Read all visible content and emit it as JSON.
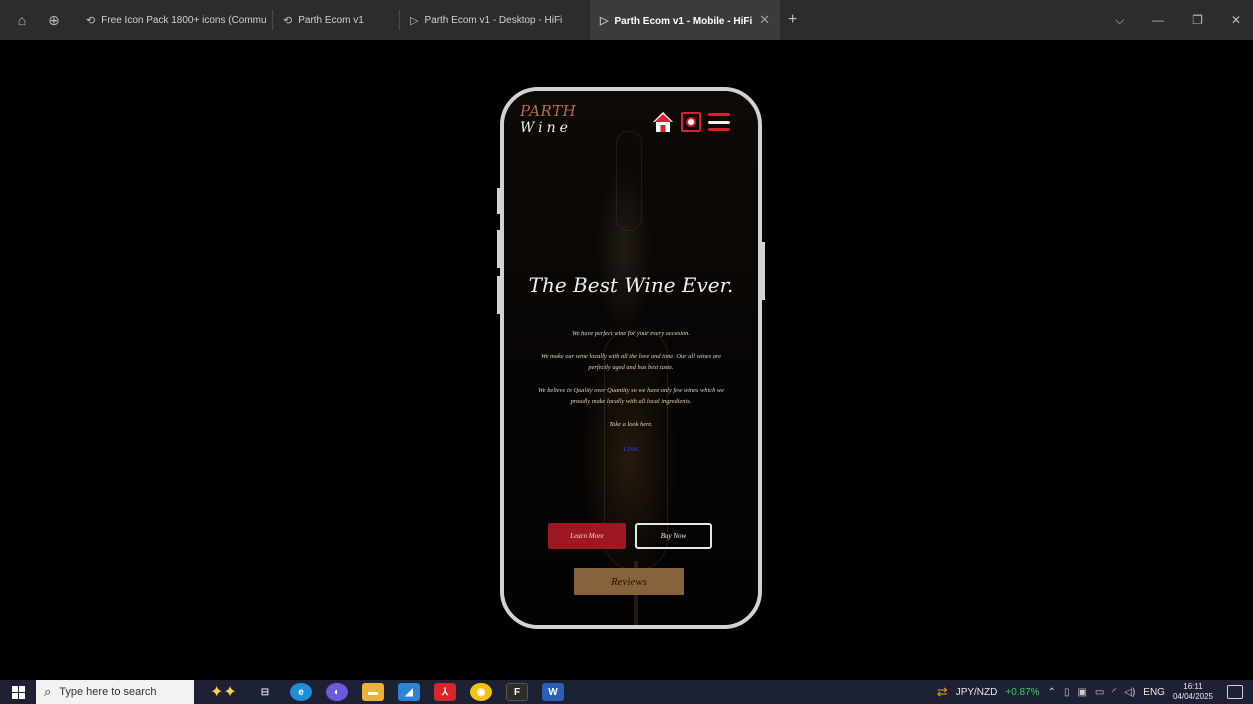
{
  "browser": {
    "tabs": [
      {
        "label": "Free Icon Pack 1800+ icons (Commu"
      },
      {
        "label": "Parth Ecom v1"
      },
      {
        "label": "Parth Ecom v1 - Desktop - HiFi"
      },
      {
        "label": "Parth Ecom v1 - Mobile - HiFi"
      }
    ],
    "new_tab": "+",
    "close_tab": "✕"
  },
  "site": {
    "logo_top": "PARTH",
    "logo_bottom": "Wine",
    "hero_title": "The Best Wine Ever.",
    "paragraphs": [
      "We have perfect wine for your every occasion.",
      "We make our wine locally with all the love and time. Our all wines are perfectly aged and has best taste.",
      "We believe in Quality over Quantity so we have only few wines which we proudly make locally with all local ingredients."
    ],
    "look_text": "Take a look here.",
    "link_text": "LINK",
    "learn_more": "Learn More",
    "buy_now": "Buy Now",
    "reviews": "Reviews"
  },
  "taskbar": {
    "search_placeholder": "Type here to search",
    "ticker": "JPY/NZD",
    "ticker_change": "+0.87%",
    "language": "ENG",
    "time": "16:11",
    "date": "04/04/2025"
  },
  "colors": {
    "accent_red": "#9e1823",
    "reviews_brown": "#86633c",
    "logo_copper": "#b56d45"
  }
}
